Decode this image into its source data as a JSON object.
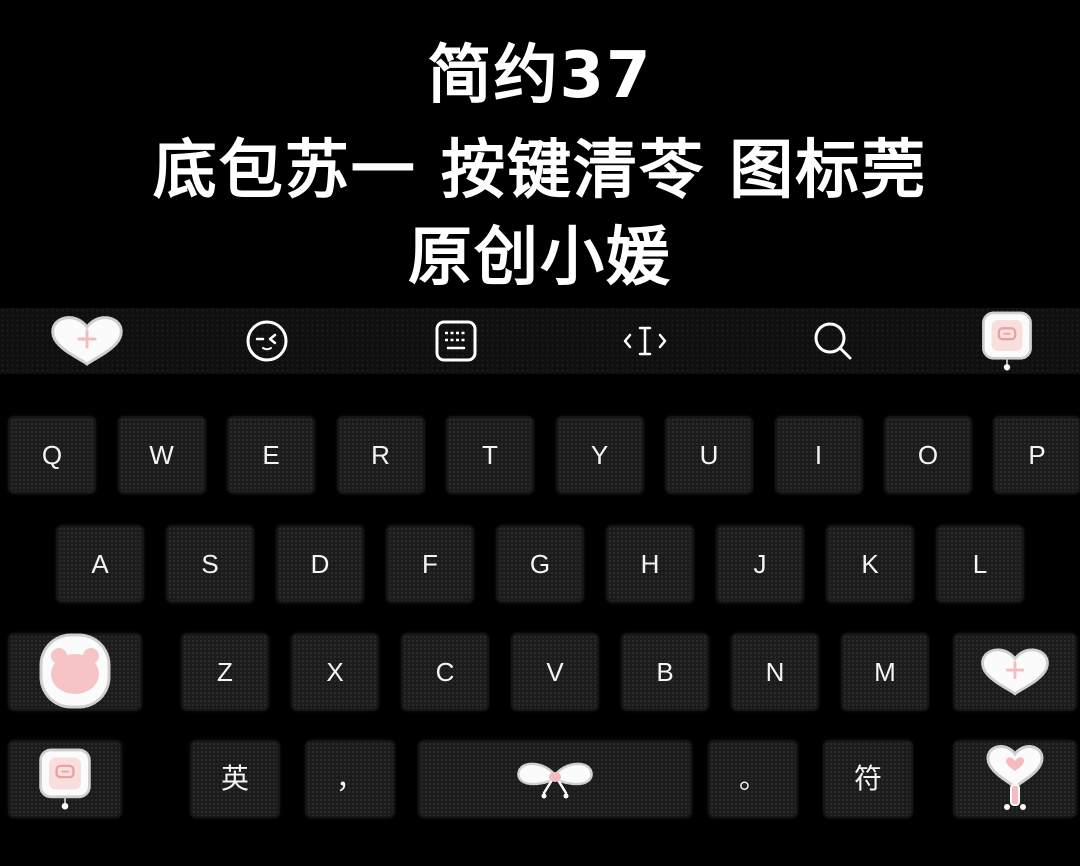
{
  "title": {
    "line1": "简约37",
    "line2": "底包苏一 按键清苓 图标莞",
    "line3": "原创小媛"
  },
  "toolbar": {
    "icons": [
      "heart-plus-icon",
      "emoji-face-icon",
      "keyboard-icon",
      "cursor-icon",
      "search-icon",
      "sticker-sign-icon"
    ]
  },
  "keyboard": {
    "row1": [
      "Q",
      "W",
      "E",
      "R",
      "T",
      "Y",
      "U",
      "I",
      "O",
      "P"
    ],
    "row2": [
      "A",
      "S",
      "D",
      "F",
      "G",
      "H",
      "J",
      "K",
      "L"
    ],
    "row3": {
      "shift_icon": "bear-sticker-icon",
      "keys": [
        "Z",
        "X",
        "C",
        "V",
        "B",
        "N",
        "M"
      ],
      "backspace_icon": "heart-plus-icon"
    },
    "row4": {
      "left_icon": "sticker-sign-icon",
      "lang_label": "英",
      "comma_label": "，",
      "space_icon": "bow-icon",
      "period_label": "。",
      "symbol_label": "符",
      "enter_icon": "heart-lollipop-icon"
    }
  },
  "colors": {
    "background": "#000000",
    "toolbar": "#0f0f0f",
    "key": "#1b1b1b",
    "text": "#ffffff",
    "accent_pink": "#f4bcbf",
    "sticker_white": "#fbfbfb"
  }
}
